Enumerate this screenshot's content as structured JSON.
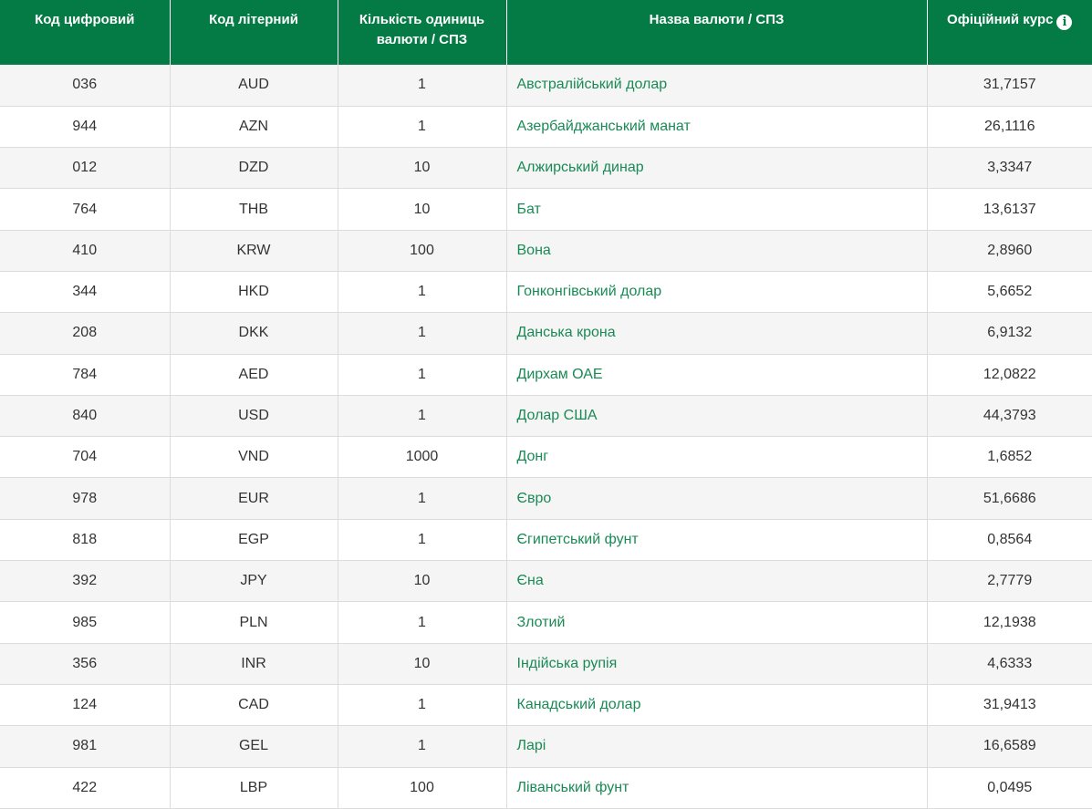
{
  "table": {
    "headers": {
      "numeric_code": "Код цифровий",
      "letter_code": "Код літерний",
      "units": "Кількість одиниць валюти / СПЗ",
      "name": "Назва валюти / СПЗ",
      "rate": "Офіційний курс"
    },
    "rate_info_icon": "i",
    "rows": [
      {
        "num": "036",
        "code": "AUD",
        "units": "1",
        "name": "Австралійський долар",
        "rate": "31,7157"
      },
      {
        "num": "944",
        "code": "AZN",
        "units": "1",
        "name": "Азербайджанський манат",
        "rate": "26,1116"
      },
      {
        "num": "012",
        "code": "DZD",
        "units": "10",
        "name": "Алжирський динар",
        "rate": "3,3347"
      },
      {
        "num": "764",
        "code": "THB",
        "units": "10",
        "name": "Бат",
        "rate": "13,6137"
      },
      {
        "num": "410",
        "code": "KRW",
        "units": "100",
        "name": "Вона",
        "rate": "2,8960"
      },
      {
        "num": "344",
        "code": "HKD",
        "units": "1",
        "name": "Гонконгівський долар",
        "rate": "5,6652"
      },
      {
        "num": "208",
        "code": "DKK",
        "units": "1",
        "name": "Данська крона",
        "rate": "6,9132"
      },
      {
        "num": "784",
        "code": "AED",
        "units": "1",
        "name": "Дирхам ОАЕ",
        "rate": "12,0822"
      },
      {
        "num": "840",
        "code": "USD",
        "units": "1",
        "name": "Долар США",
        "rate": "44,3793"
      },
      {
        "num": "704",
        "code": "VND",
        "units": "1000",
        "name": "Донг",
        "rate": "1,6852"
      },
      {
        "num": "978",
        "code": "EUR",
        "units": "1",
        "name": "Євро",
        "rate": "51,6686"
      },
      {
        "num": "818",
        "code": "EGP",
        "units": "1",
        "name": "Єгипетський фунт",
        "rate": "0,8564"
      },
      {
        "num": "392",
        "code": "JPY",
        "units": "10",
        "name": "Єна",
        "rate": "2,7779"
      },
      {
        "num": "985",
        "code": "PLN",
        "units": "1",
        "name": "Злотий",
        "rate": "12,1938"
      },
      {
        "num": "356",
        "code": "INR",
        "units": "10",
        "name": "Індійська рупія",
        "rate": "4,6333"
      },
      {
        "num": "124",
        "code": "CAD",
        "units": "1",
        "name": "Канадський долар",
        "rate": "31,9413"
      },
      {
        "num": "981",
        "code": "GEL",
        "units": "1",
        "name": "Ларі",
        "rate": "16,6589"
      },
      {
        "num": "422",
        "code": "LBP",
        "units": "100",
        "name": "Ліванський фунт",
        "rate": "0,0495"
      }
    ]
  },
  "colors": {
    "header_bg": "#047a44",
    "link": "#1a8a55",
    "row_alt": "#f5f5f5"
  }
}
